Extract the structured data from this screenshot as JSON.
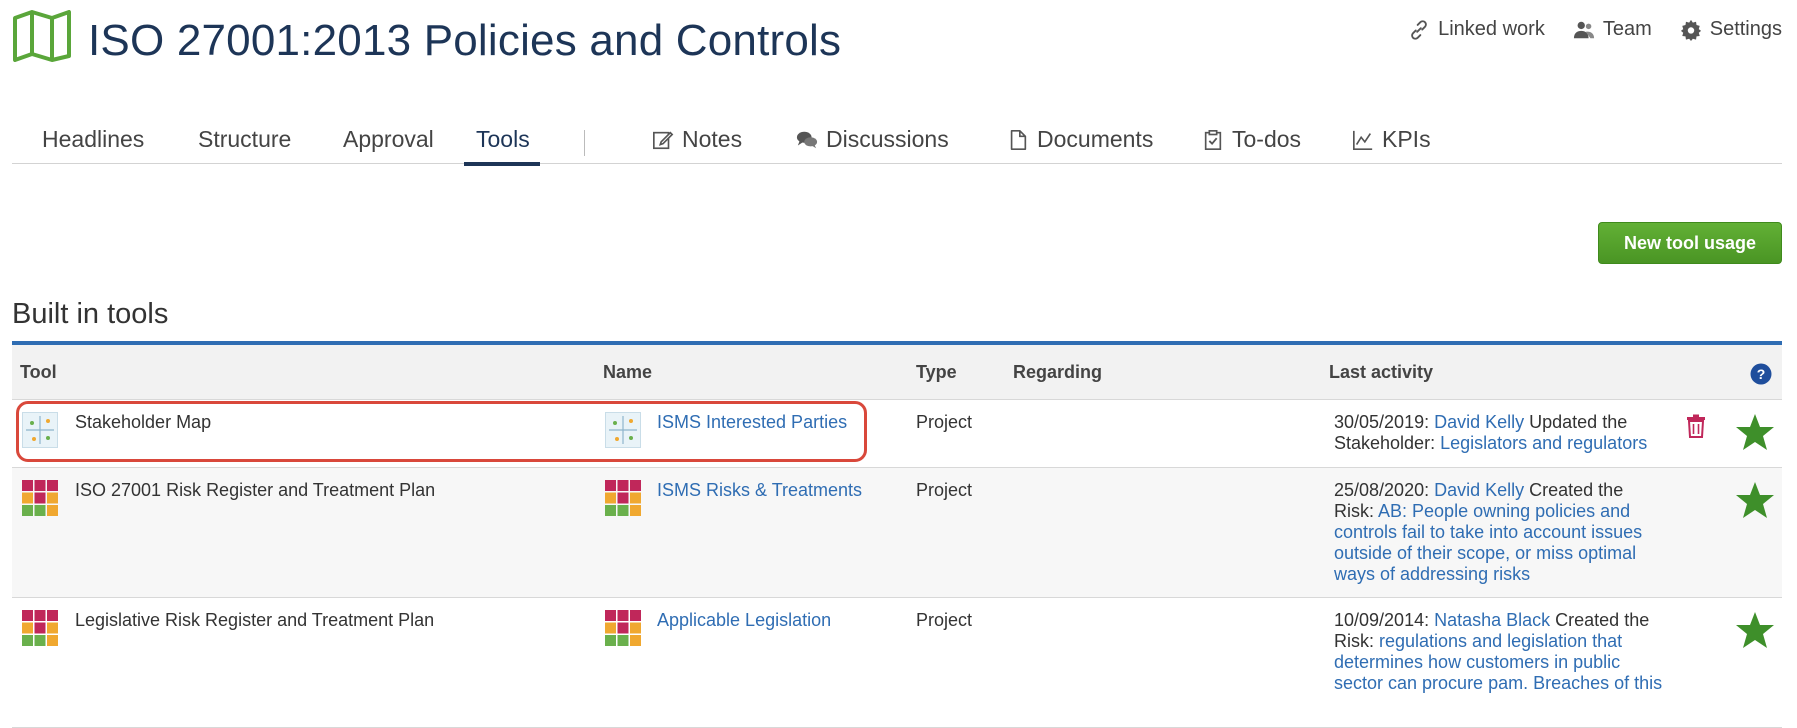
{
  "header": {
    "title": "ISO 27001:2013 Policies and Controls",
    "links": {
      "linked_work": "Linked work",
      "team": "Team",
      "settings": "Settings"
    }
  },
  "tabs": {
    "headlines": "Headlines",
    "structure": "Structure",
    "approval": "Approval",
    "tools": "Tools",
    "notes": "Notes",
    "discussions": "Discussions",
    "documents": "Documents",
    "todos": "To-dos",
    "kpis": "KPIs",
    "active": "tools"
  },
  "actions": {
    "new_tool_usage": "New tool usage"
  },
  "section": {
    "title": "Built in tools"
  },
  "table": {
    "headers": {
      "tool": "Tool",
      "name": "Name",
      "type": "Type",
      "regarding": "Regarding",
      "last_activity": "Last activity"
    },
    "rows": [
      {
        "tool": "Stakeholder Map",
        "name": "ISMS Interested Parties",
        "type": "Project",
        "regarding": "",
        "activity": {
          "date": "30/05/2019: ",
          "user": "David Kelly",
          "action": " Updated the Stakeholder: ",
          "target": "Legislators and regulators"
        }
      },
      {
        "tool": "ISO 27001 Risk Register and Treatment Plan",
        "name": "ISMS Risks & Treatments",
        "type": "Project",
        "regarding": "",
        "activity": {
          "date": "25/08/2020: ",
          "user": "David Kelly",
          "action": " Created the Risk: ",
          "target": "AB: People owning policies and controls fail to take into account issues outside of their scope, or miss optimal ways of addressing risks"
        }
      },
      {
        "tool": "Legislative Risk Register and Treatment Plan",
        "name": "Applicable Legislation",
        "type": "Project",
        "regarding": "",
        "activity": {
          "date": "10/09/2014: ",
          "user": "Natasha Black",
          "action": " Created the Risk: ",
          "target": "regulations and legislation that determines how customers in public sector can procure pam. Breaches of this"
        }
      }
    ]
  },
  "colors": {
    "title": "#1d3557",
    "link": "#2f6db3",
    "accent_green": "#4a9524",
    "star": "#3e8f2a",
    "trash": "#c0275a",
    "highlight": "#d9483b",
    "table_border": "#2f6db3"
  },
  "icons": {
    "logo": "map-icon",
    "linked_work": "link-icon",
    "team": "team-icon",
    "settings": "gear-icon",
    "notes": "edit-icon",
    "discussions": "chat-icon",
    "documents": "document-icon",
    "todos": "clipboard-check-icon",
    "kpis": "line-chart-icon",
    "help": "help-icon",
    "trash": "trash-icon",
    "star": "star-icon",
    "stakeholder_map": "stakeholder-map-icon",
    "risk_register": "risk-register-icon"
  }
}
